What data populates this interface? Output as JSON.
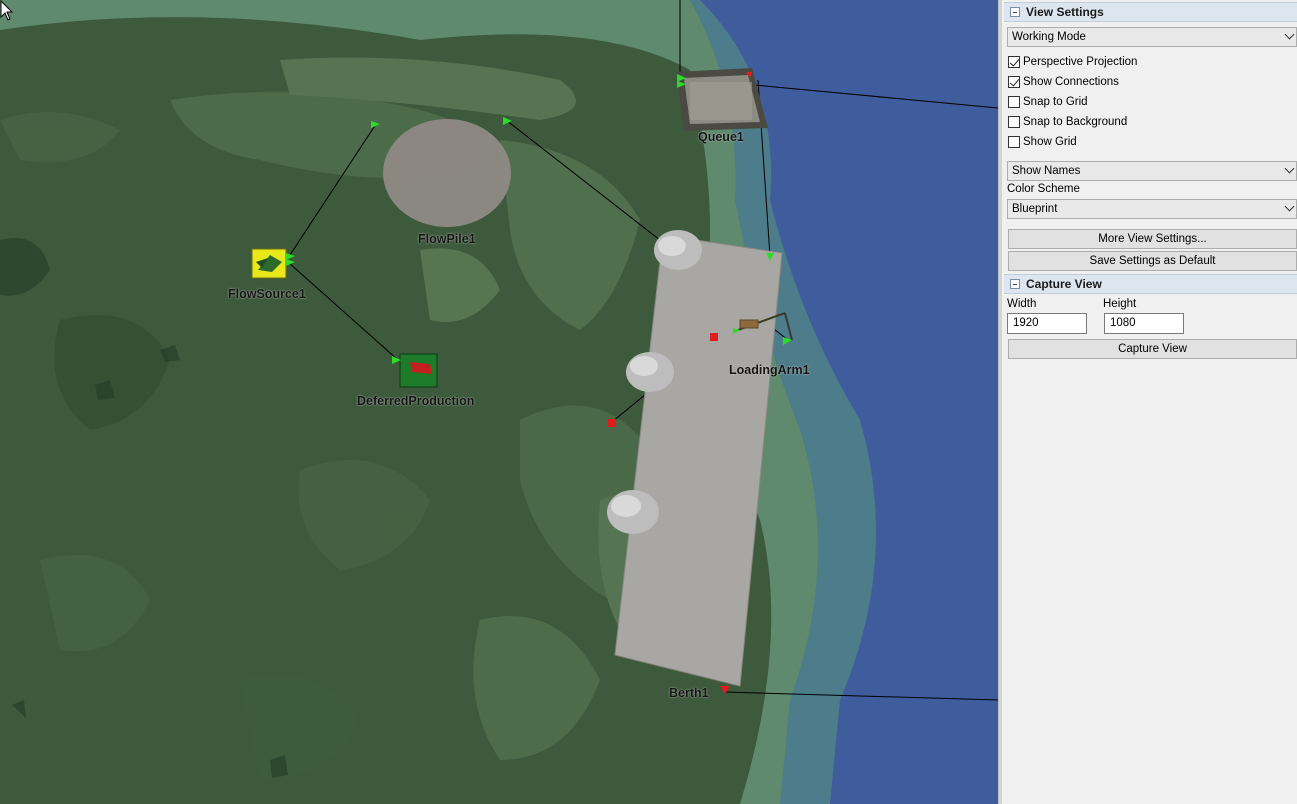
{
  "viewport": {
    "objects": [
      {
        "id": "flowpile",
        "label": "FlowPile1"
      },
      {
        "id": "flowsource",
        "label": "FlowSource1"
      },
      {
        "id": "deferred",
        "label": "DeferredProduction"
      },
      {
        "id": "queue",
        "label": "Queue1"
      },
      {
        "id": "loadingarm",
        "label": "LoadingArm1"
      },
      {
        "id": "berth",
        "label": "Berth1"
      }
    ]
  },
  "panel": {
    "view_settings": {
      "title": "View Settings",
      "mode_dropdown": "Working Mode",
      "checkboxes": [
        {
          "label": "Perspective Projection",
          "checked": true
        },
        {
          "label": "Show Connections",
          "checked": true
        },
        {
          "label": "Snap to Grid",
          "checked": false
        },
        {
          "label": "Snap to Background",
          "checked": false
        },
        {
          "label": "Show Grid",
          "checked": false
        }
      ],
      "names_dropdown": "Show Names",
      "color_scheme_label": "Color Scheme",
      "color_scheme_value": "Blueprint",
      "more_button": "More View Settings...",
      "save_button": "Save Settings as Default"
    },
    "capture_view": {
      "title": "Capture View",
      "width_label": "Width",
      "height_label": "Height",
      "width_value": "1920",
      "height_value": "1080",
      "capture_button": "Capture View"
    }
  }
}
